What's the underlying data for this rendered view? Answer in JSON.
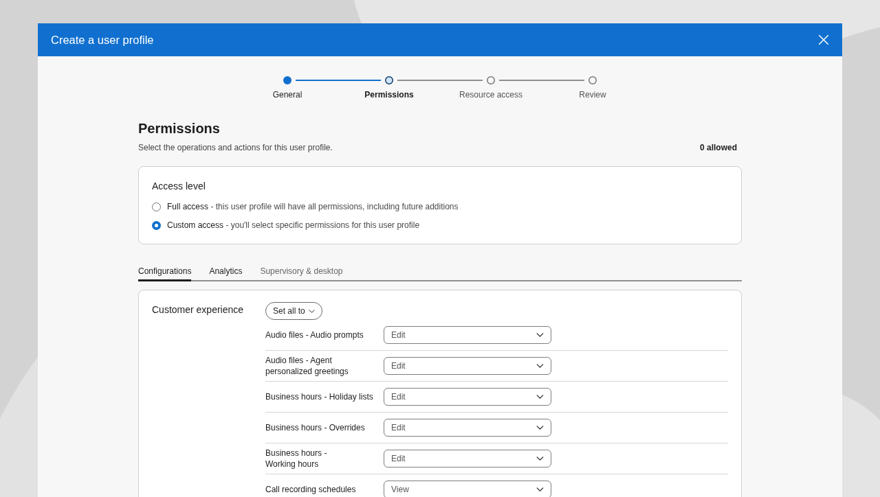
{
  "dialog": {
    "title": "Create a user profile"
  },
  "stepper": [
    {
      "label": "General",
      "completed": true,
      "selected": false
    },
    {
      "label": "Permissions",
      "completed": false,
      "selected": true
    },
    {
      "label": "Resource access",
      "completed": false,
      "selected": false
    },
    {
      "label": "Review",
      "completed": false,
      "selected": false
    }
  ],
  "section": {
    "title": "Permissions",
    "subtitle": "Select the operations and actions for this user profile.",
    "allowed_count": "0 allowed"
  },
  "access_level": {
    "title": "Access level",
    "options": [
      {
        "label": "Full access",
        "description": "- this user profile will have all permissions, including future additions",
        "selected": false
      },
      {
        "label": "Custom access",
        "description": "- you'll select specific permissions for this user profile",
        "selected": true
      }
    ]
  },
  "tabs": [
    {
      "label": "Configurations",
      "selected": true,
      "disabled": false
    },
    {
      "label": "Analytics",
      "selected": false,
      "disabled": false
    },
    {
      "label": "Supervisory & desktop",
      "selected": false,
      "disabled": true
    }
  ],
  "group": {
    "title": "Customer experience",
    "set_all_button": "Set all to",
    "rows": [
      {
        "label": "Audio files - Audio prompts",
        "value": "Edit"
      },
      {
        "label": "Audio files - Agent\npersonalized greetings",
        "value": "Edit"
      },
      {
        "label": "Business hours - Holiday lists",
        "value": "Edit"
      },
      {
        "label": "Business hours - Overrides",
        "value": "Edit"
      },
      {
        "label": "Business hours -\nWorking hours",
        "value": "Edit"
      },
      {
        "label": "Call recording schedules",
        "value": "View"
      }
    ]
  }
}
